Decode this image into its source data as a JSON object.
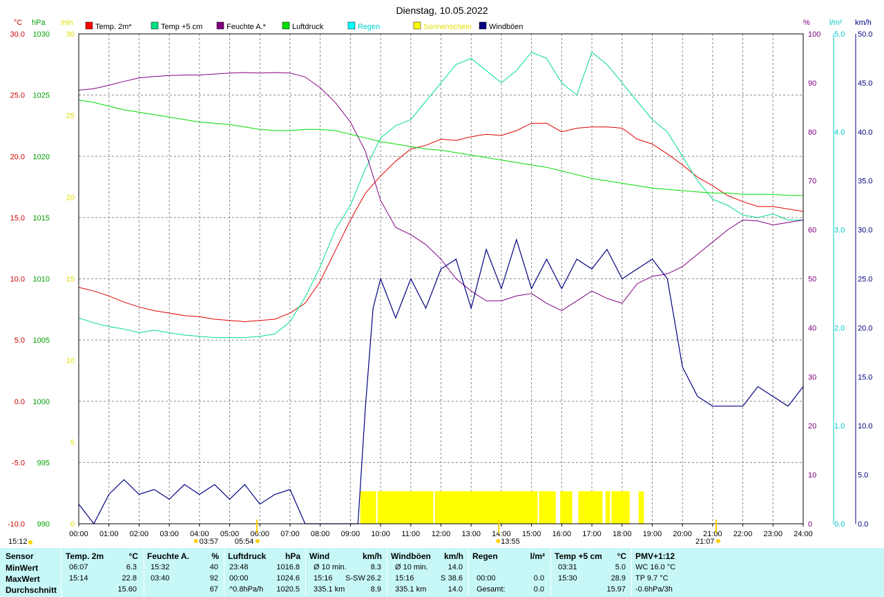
{
  "chart_data": {
    "type": "line",
    "title": "Dienstag, 10.05.2022",
    "x_ticks": [
      "00:00",
      "01:00",
      "02:00",
      "03:00",
      "04:00",
      "05:00",
      "06:00",
      "07:00",
      "08:00",
      "09:00",
      "10:00",
      "11:00",
      "12:00",
      "13:00",
      "14:00",
      "15:00",
      "16:00",
      "17:00",
      "18:00",
      "19:00",
      "20:00",
      "21:00",
      "22:00",
      "23:00",
      "24:00"
    ],
    "xlim": [
      0,
      24
    ],
    "axis_units": {
      "temp": "°C",
      "pressure": "hPa",
      "sun": "min",
      "humidity": "%",
      "rain": "l/m²",
      "wind": "km/h"
    },
    "axes": {
      "temp": {
        "ylim": [
          -10,
          30
        ],
        "ticks": [
          "30.0",
          "25.0",
          "20.0",
          "15.0",
          "10.0",
          "5.0",
          "0.0",
          "-5.0",
          "-10.0"
        ],
        "color": "#cc0000"
      },
      "pressure": {
        "ylim": [
          990,
          1030
        ],
        "ticks": [
          "1030",
          "1025",
          "1020",
          "1015",
          "1010",
          "1005",
          "1000",
          "995",
          "990"
        ],
        "color": "#00a000"
      },
      "sun": {
        "ylim": [
          0,
          30
        ],
        "ticks": [
          "30",
          "25",
          "20",
          "15",
          "10",
          "5",
          "0"
        ],
        "color": "#e0e000"
      },
      "humidity": {
        "ylim": [
          0,
          100
        ],
        "ticks": [
          "100",
          "90",
          "80",
          "70",
          "60",
          "50",
          "40",
          "30",
          "20",
          "10",
          "0"
        ],
        "color": "#800080"
      },
      "rain": {
        "ylim": [
          0,
          5
        ],
        "ticks": [
          "5.0",
          "4.0",
          "3.0",
          "2.0",
          "1.0",
          "0.0"
        ],
        "color": "#00c8c8"
      },
      "wind": {
        "ylim": [
          0,
          50
        ],
        "ticks": [
          "50.0",
          "45.0",
          "40.0",
          "35.0",
          "30.0",
          "25.0",
          "20.0",
          "15.0",
          "10.0",
          "5.0",
          "0.0"
        ],
        "color": "#000080"
      }
    },
    "legend": [
      {
        "label": "Temp. 2m*",
        "color": "#ff0000",
        "text_color": "#000000"
      },
      {
        "label": "Temp +5 cm",
        "color": "#00e080",
        "text_color": "#000000"
      },
      {
        "label": "Feuchte A.*",
        "color": "#800080",
        "text_color": "#000000"
      },
      {
        "label": "Luftdruck",
        "color": "#00dd00",
        "text_color": "#000000"
      },
      {
        "label": "Regen",
        "color": "#00ffff",
        "text_color": "#00d0d0"
      },
      {
        "label": "Sonnenschein",
        "color": "#ffff00",
        "text_color": "#e0e000"
      },
      {
        "label": "Windböen",
        "color": "#000080",
        "text_color": "#000000"
      }
    ],
    "series": [
      {
        "name": "Temp. 2m*",
        "axis": "temp",
        "color": "#e00000",
        "x": [
          0,
          0.5,
          1,
          1.5,
          2,
          2.5,
          3,
          3.5,
          4,
          4.5,
          5,
          5.5,
          6,
          6.5,
          7,
          7.5,
          8,
          8.5,
          9,
          9.5,
          10,
          10.5,
          11,
          11.5,
          12,
          12.5,
          13,
          13.5,
          14,
          14.5,
          15,
          15.5,
          16,
          16.5,
          17,
          17.5,
          18,
          18.5,
          19,
          19.5,
          20,
          20.5,
          21,
          21.5,
          22,
          22.5,
          23,
          23.5,
          24
        ],
        "y": [
          9.3,
          9.0,
          8.6,
          8.1,
          7.7,
          7.4,
          7.2,
          7.0,
          6.9,
          6.7,
          6.6,
          6.5,
          6.6,
          6.7,
          7.2,
          8.0,
          9.8,
          12.3,
          14.8,
          17.0,
          18.4,
          19.6,
          20.6,
          20.9,
          21.4,
          21.3,
          21.6,
          21.8,
          21.7,
          22.1,
          22.7,
          22.7,
          22.0,
          22.3,
          22.4,
          22.4,
          22.3,
          21.4,
          21.0,
          20.2,
          19.3,
          18.3,
          17.6,
          16.8,
          16.3,
          15.9,
          15.9,
          15.7,
          15.5
        ]
      },
      {
        "name": "Temp +5 cm",
        "axis": "temp",
        "color": "#00dd88",
        "x": [
          0,
          0.5,
          1,
          1.5,
          2,
          2.5,
          3,
          3.5,
          4,
          4.5,
          5,
          5.5,
          6,
          6.5,
          7,
          7.5,
          8,
          8.5,
          9,
          9.5,
          10,
          10.5,
          11,
          11.5,
          12,
          12.5,
          13,
          13.5,
          14,
          14.5,
          15,
          15.5,
          16,
          16.5,
          17,
          17.5,
          18,
          18.5,
          19,
          19.5,
          20,
          20.5,
          21,
          21.5,
          22,
          22.5,
          23,
          23.5,
          24
        ],
        "y": [
          6.8,
          6.4,
          6.1,
          5.9,
          5.6,
          5.8,
          5.6,
          5.4,
          5.3,
          5.2,
          5.2,
          5.2,
          5.3,
          5.5,
          6.5,
          8.5,
          11.0,
          14.0,
          16.0,
          19.0,
          21.5,
          22.5,
          23.0,
          24.5,
          26.0,
          27.5,
          28.0,
          27.0,
          26.0,
          27.0,
          28.5,
          28.0,
          26.0,
          25.0,
          28.5,
          27.5,
          26.0,
          24.5,
          23.0,
          22.0,
          20.0,
          18.0,
          16.5,
          16.0,
          15.2,
          15.0,
          15.3,
          14.8,
          14.8
        ]
      },
      {
        "name": "Feuchte A.*",
        "axis": "humidity",
        "color": "#800080",
        "x": [
          0,
          0.5,
          1,
          1.5,
          2,
          2.5,
          3,
          3.5,
          4,
          4.5,
          5,
          5.5,
          6,
          6.5,
          7,
          7.5,
          8,
          8.5,
          9,
          9.5,
          10,
          10.5,
          11,
          11.5,
          12,
          12.5,
          13,
          13.5,
          14,
          14.5,
          15,
          15.5,
          16,
          16.5,
          17,
          17.5,
          18,
          18.5,
          19,
          19.5,
          20,
          20.5,
          21,
          21.5,
          22,
          22.5,
          23,
          23.5,
          24
        ],
        "y": [
          88.5,
          88.8,
          89.5,
          90.3,
          91.0,
          91.3,
          91.5,
          91.6,
          91.6,
          91.8,
          92.0,
          92.1,
          92.0,
          92.1,
          92.0,
          91.2,
          89.0,
          86.0,
          82.0,
          76.0,
          66.0,
          60.5,
          59.0,
          57.0,
          54.0,
          50.0,
          47.5,
          45.5,
          45.5,
          46.5,
          47.0,
          45.0,
          43.5,
          45.5,
          47.5,
          46.0,
          45.0,
          49.0,
          50.5,
          51.0,
          52.5,
          55.0,
          57.5,
          60.0,
          62.0,
          61.8,
          61.0,
          61.5,
          62.0
        ]
      },
      {
        "name": "Luftdruck",
        "axis": "pressure",
        "color": "#00dd00",
        "x": [
          0,
          0.5,
          1,
          1.5,
          2,
          2.5,
          3,
          3.5,
          4,
          4.5,
          5,
          5.5,
          6,
          6.5,
          7,
          7.5,
          8,
          8.5,
          9,
          9.5,
          10,
          10.5,
          11,
          11.5,
          12,
          12.5,
          13,
          13.5,
          14,
          14.5,
          15,
          15.5,
          16,
          16.5,
          17,
          17.5,
          18,
          18.5,
          19,
          19.5,
          20,
          20.5,
          21,
          21.5,
          22,
          22.5,
          23,
          23.5,
          24
        ],
        "y": [
          1024.6,
          1024.4,
          1024.1,
          1023.8,
          1023.6,
          1023.4,
          1023.2,
          1023.0,
          1022.8,
          1022.7,
          1022.6,
          1022.4,
          1022.2,
          1022.1,
          1022.1,
          1022.2,
          1022.2,
          1022.1,
          1021.8,
          1021.5,
          1021.2,
          1021.0,
          1020.8,
          1020.6,
          1020.5,
          1020.3,
          1020.1,
          1019.9,
          1019.7,
          1019.5,
          1019.3,
          1019.1,
          1018.8,
          1018.5,
          1018.2,
          1018.0,
          1017.8,
          1017.6,
          1017.4,
          1017.3,
          1017.2,
          1017.1,
          1017.0,
          1017.0,
          1016.9,
          1016.9,
          1016.9,
          1016.8,
          1016.8
        ]
      },
      {
        "name": "Windböen",
        "axis": "wind",
        "color": "#000080",
        "x": [
          0,
          0.5,
          1,
          1.5,
          2,
          2.5,
          3,
          3.5,
          4,
          4.5,
          5,
          5.5,
          6,
          6.5,
          7,
          7.5,
          8,
          8.5,
          9,
          9.25,
          9.5,
          9.75,
          10,
          10.5,
          11,
          11.5,
          12,
          12.5,
          13,
          13.5,
          14,
          14.5,
          15,
          15.5,
          16,
          16.5,
          17,
          17.5,
          18,
          18.5,
          19,
          19.5,
          20,
          20.5,
          21,
          21.5,
          22,
          22.5,
          23,
          23.5,
          24
        ],
        "y": [
          2.0,
          0.0,
          3.0,
          4.5,
          3.0,
          3.5,
          2.5,
          4.0,
          3.0,
          4.0,
          2.5,
          4.0,
          2.0,
          3.0,
          3.5,
          0.0,
          0.0,
          0.0,
          0.0,
          0.0,
          12.0,
          22.0,
          25.0,
          21.0,
          25.0,
          22.0,
          26.0,
          27.0,
          22.0,
          28.0,
          24.0,
          29.0,
          24.0,
          27.0,
          24.0,
          27.0,
          26.0,
          28.0,
          25.0,
          26.0,
          27.0,
          25.0,
          16.0,
          13.0,
          12.0,
          12.0,
          12.0,
          14.0,
          13.0,
          12.0,
          14.0
        ]
      }
    ],
    "sunshine_blocks": [
      [
        9.33,
        9.85
      ],
      [
        9.9,
        11.75
      ],
      [
        11.8,
        15.2
      ],
      [
        15.25,
        15.8
      ],
      [
        15.95,
        16.35
      ],
      [
        16.55,
        17.35
      ],
      [
        17.45,
        17.6
      ],
      [
        17.65,
        18.25
      ],
      [
        18.55,
        18.72
      ]
    ],
    "markers": {
      "sunrise": "05:54",
      "sunset": "21:07",
      "moon_rise": "03:57",
      "sun_max": "13:55",
      "current_time": "15:12"
    }
  },
  "footer": {
    "headers": {
      "sensor": "Sensor",
      "temp2m": "Temp. 2m",
      "temp2m_unit": "°C",
      "hum": "Feuchte A.",
      "hum_unit": "%",
      "press": "Luftdruck",
      "press_unit": "hPa",
      "wind": "Wind",
      "wind_unit": "km/h",
      "gust": "Windböen",
      "gust_unit": "km/h",
      "rain": "Regen",
      "rain_unit": "l/m²",
      "temp5": "Temp +5 cm",
      "temp5_unit": "°C",
      "pmv": "PMV+1:12"
    },
    "row_labels": [
      "MinWert",
      "MaxWert",
      "Durchschnitt"
    ],
    "temp2m": [
      [
        "06:07",
        "6.3"
      ],
      [
        "15:14",
        "22.8"
      ],
      [
        "",
        "15.60"
      ]
    ],
    "hum": [
      [
        "15:32",
        "40"
      ],
      [
        "03:40",
        "92"
      ],
      [
        "",
        "67"
      ]
    ],
    "press": [
      [
        "23:48",
        "1016.8"
      ],
      [
        "00:00",
        "1024.6"
      ],
      [
        "^0.8hPa/h",
        "1020.5"
      ]
    ],
    "wind": [
      [
        "Ø 10 min.",
        "",
        "8.3"
      ],
      [
        "15:16",
        "S-SW",
        "26.2"
      ],
      [
        "335.1 km",
        "",
        "8.9"
      ]
    ],
    "gust": [
      [
        "Ø 10 min.",
        "",
        "14.0"
      ],
      [
        "15:16",
        "S",
        "38.6"
      ],
      [
        "335.1 km",
        "",
        "14.0"
      ]
    ],
    "rain": [
      [
        "",
        ""
      ],
      [
        "00:00",
        "0.0"
      ],
      [
        "Gesamt:",
        "0.0"
      ]
    ],
    "temp5": [
      [
        "03:31",
        "5.0"
      ],
      [
        "15:30",
        "28.9"
      ],
      [
        "",
        "15.97"
      ]
    ],
    "pmv": [
      "WC 16.0 °C",
      "TP 9.7 °C",
      "-0.6hPa/3h"
    ]
  }
}
